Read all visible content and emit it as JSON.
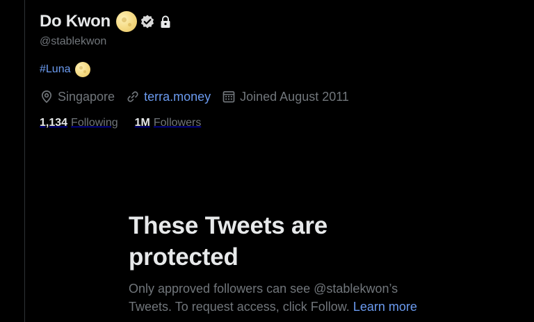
{
  "profile": {
    "display_name": "Do Kwon",
    "handle": "@stablekwon",
    "bio_hashtag": "#Luna",
    "location": "Singapore",
    "website": "terra.money",
    "joined": "Joined August 2011",
    "following_count": "1,134",
    "following_label": "Following",
    "followers_count": "1M",
    "followers_label": "Followers"
  },
  "icons": {
    "name_emoji": "full-moon-icon",
    "verified": "verified-badge-icon",
    "protected": "lock-icon",
    "bio_emoji": "full-moon-icon",
    "location": "location-pin-icon",
    "website": "link-icon",
    "joined": "calendar-icon"
  },
  "protected_notice": {
    "title": "These Tweets are protected",
    "body": "Only approved followers can see @stablekwon’s Tweets. To request access, click Follow.",
    "link_label": "Learn more"
  },
  "colors": {
    "background": "#000000",
    "primary_text": "#e7e9ea",
    "secondary_text": "#71767b",
    "link": "#6b9bf0",
    "border": "#2f3336"
  }
}
